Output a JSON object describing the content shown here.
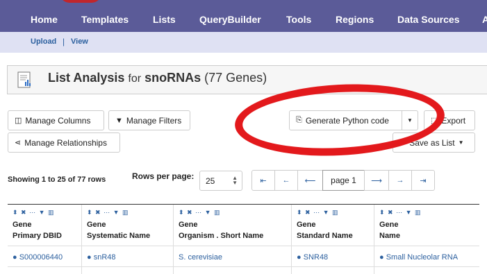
{
  "nav": {
    "items": [
      "Home",
      "Templates",
      "Lists",
      "QueryBuilder",
      "Tools",
      "Regions",
      "Data Sources",
      "A"
    ]
  },
  "subnav": {
    "upload": "Upload",
    "sep": "|",
    "view": "View"
  },
  "header": {
    "title": "List Analysis",
    "for": "for",
    "list_name": "snoRNAs",
    "count": "(77 Genes)"
  },
  "toolbar": {
    "manage_columns": "Manage Columns",
    "manage_filters": "Manage Filters",
    "generate_python": "Generate Python code",
    "export": "Export",
    "manage_relationships": "Manage Relationships",
    "save_as_list": "Save as List"
  },
  "pagination": {
    "showing": "Showing 1 to 25 of 77 rows",
    "rows_per_page_label": "Rows per page:",
    "rows_per_page_value": "25",
    "page_label": "page 1",
    "first": "⇤",
    "prev_fast": "←",
    "prev": "⟵",
    "next": "⟶",
    "next_fast": "→",
    "last": "⇥"
  },
  "table": {
    "columns": [
      {
        "line1": "Gene",
        "line2": "Primary DBID"
      },
      {
        "line1": "Gene",
        "line2": "Systematic Name"
      },
      {
        "line1": "Gene",
        "line2": "Organism . Short Name"
      },
      {
        "line1": "Gene",
        "line2": "Standard Name"
      },
      {
        "line1": "Gene",
        "line2": "Name"
      }
    ],
    "rows": [
      [
        "S000006440",
        "snR48",
        "S. cerevisiae",
        "SNR48",
        "Small Nucleolar RNA"
      ]
    ]
  },
  "colors": {
    "nav_bg": "#5b5b98",
    "subnav_bg": "#dfe1f3",
    "link": "#2b5f9e",
    "annotation": "#e3191c"
  }
}
